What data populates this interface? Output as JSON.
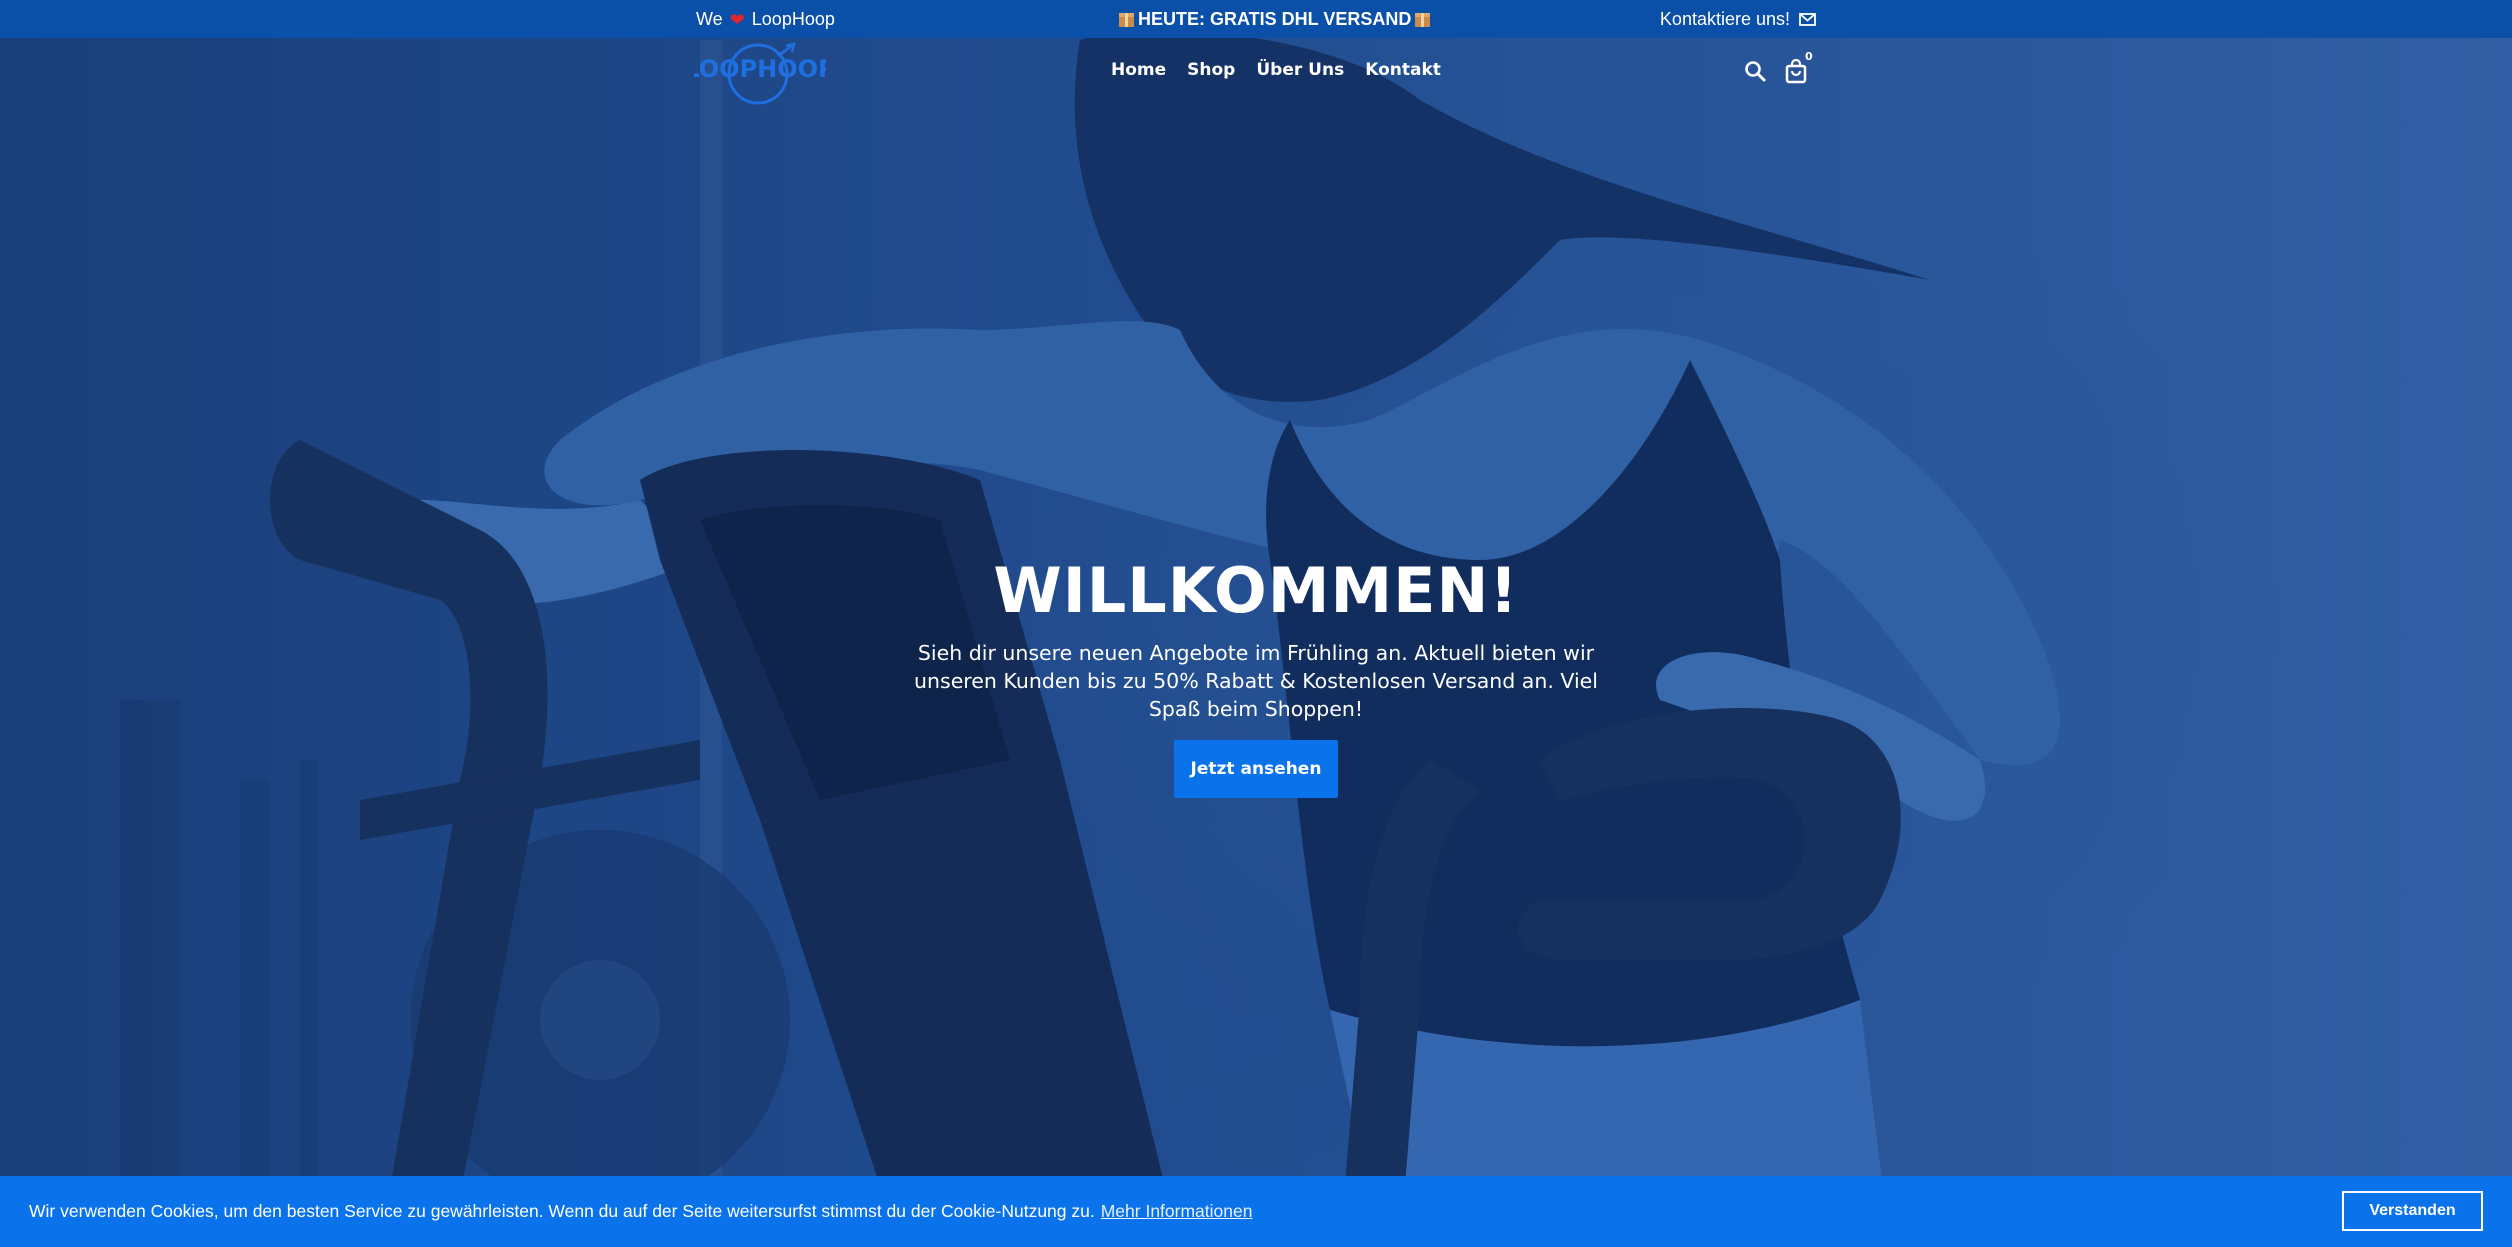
{
  "topbar": {
    "left_prefix": "We",
    "left_suffix": "LoopHoop",
    "center_text": "HEUTE: GRATIS DHL VERSAND",
    "right_text": "Kontaktiere uns!"
  },
  "header": {
    "logo_text": "LOOPHOOP",
    "nav": [
      "Home",
      "Shop",
      "Über Uns",
      "Kontakt"
    ],
    "cart_count": "0"
  },
  "hero": {
    "title": "WILLKOMMEN!",
    "text": "Sieh dir unsere neuen Angebote im Frühling an. Aktuell bieten wir unseren Kunden bis zu 50% Rabatt & Kostenlosen Versand an. Viel Spaß beim Shoppen!",
    "button_label": "Jetzt ansehen"
  },
  "cookie": {
    "message": "Wir verwenden Cookies, um den besten Service zu gewährleisten. Wenn du auf der Seite weitersurfst stimmst du der Cookie-Nutzung zu.",
    "more_link": "Mehr Informationen",
    "accept_label": "Verstanden"
  },
  "colors": {
    "topbar": "#0a4fa8",
    "accent": "#0a73ec",
    "heart": "#e3262e"
  },
  "icons": [
    "heart-icon",
    "package-icon",
    "mail-icon",
    "search-icon",
    "shopping-bag-icon"
  ]
}
